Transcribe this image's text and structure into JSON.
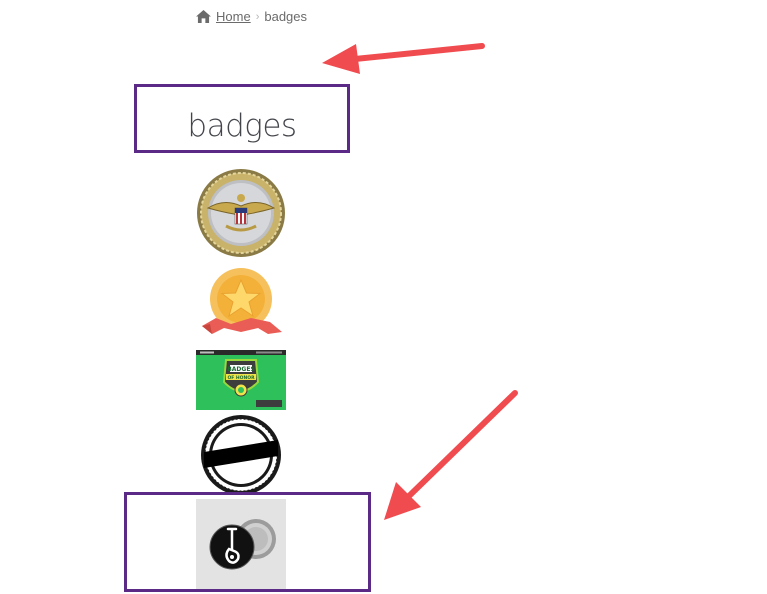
{
  "breadcrumb": {
    "home_icon": "home-icon",
    "home_label": "Home",
    "separator_icon": "chevron-right-icon",
    "current_label": "badges"
  },
  "page": {
    "title": "badges"
  },
  "badges": [
    {
      "name": "eagle-seal-badge",
      "description_icon": "gold-eagle-seal"
    },
    {
      "name": "gold-star-ribbon-badge",
      "description_icon": "gold-star-medal"
    },
    {
      "name": "badges-of-honor-card",
      "text_lines": [
        "BADGES",
        "OF HONOR"
      ]
    },
    {
      "name": "black-white-seal-badge",
      "description_icon": "black-seal"
    },
    {
      "name": "guitar-pin-button-badge",
      "description_icon": "pin-button"
    }
  ],
  "annotations": {
    "box_color": "#5b2a86",
    "arrow_color": "#f04b4f"
  }
}
